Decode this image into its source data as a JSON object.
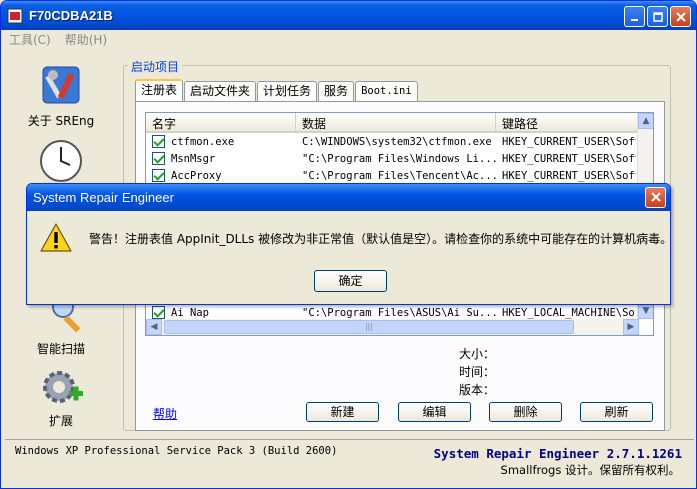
{
  "window": {
    "title": "F70CDBA21B"
  },
  "menu": {
    "tools": "工具(C)",
    "help": "帮助(H)"
  },
  "sidebar": {
    "about": "关于 SREng",
    "scan": "智能扫描",
    "extend": "扩展"
  },
  "group": {
    "title": "启动项目"
  },
  "tabs": [
    "注册表",
    "启动文件夹",
    "计划任务",
    "服务",
    "Boot.ini"
  ],
  "list": {
    "columns": [
      "名字",
      "数据",
      "键路径"
    ],
    "rows": [
      {
        "name": "ctfmon.exe",
        "data": "C:\\WINDOWS\\system32\\ctfmon.exe",
        "key": "HKEY_CURRENT_USER\\Soft"
      },
      {
        "name": "MsnMsgr",
        "data": "\"C:\\Program Files\\Windows Li...",
        "key": "HKEY_CURRENT_USER\\Soft"
      },
      {
        "name": "AccProxy",
        "data": "\"C:\\Program Files\\Tencent\\Ac...",
        "key": "HKEY_CURRENT_USER\\Soft"
      },
      {
        "name": "Ai Nap",
        "data": "\"C:\\Program Files\\ASUS\\Ai Su...",
        "key": "HKEY_LOCAL_MACHINE\\Soft"
      }
    ]
  },
  "info": {
    "size": "大小：",
    "time": "时间：",
    "version": "版本："
  },
  "buttons": {
    "help": "帮助",
    "new": "新建",
    "edit": "编辑",
    "delete": "删除",
    "refresh": "刷新"
  },
  "status": {
    "os": "Windows XP Professional Service Pack 3 (Build 2600)",
    "product": "System Repair Engineer 2.7.1.1261",
    "copyright": "Smallfrogs 设计。保留所有权利。"
  },
  "dialog": {
    "title": "System Repair Engineer",
    "message": "警告！注册表值 AppInit_DLLs 被修改为非正常值（默认值是空）。请检查你的系统中可能存在的计算机病毒。",
    "ok": "确定"
  },
  "colors": {
    "titlebar": "#0054e3",
    "link": "#0000ff",
    "status_product": "#000080"
  }
}
